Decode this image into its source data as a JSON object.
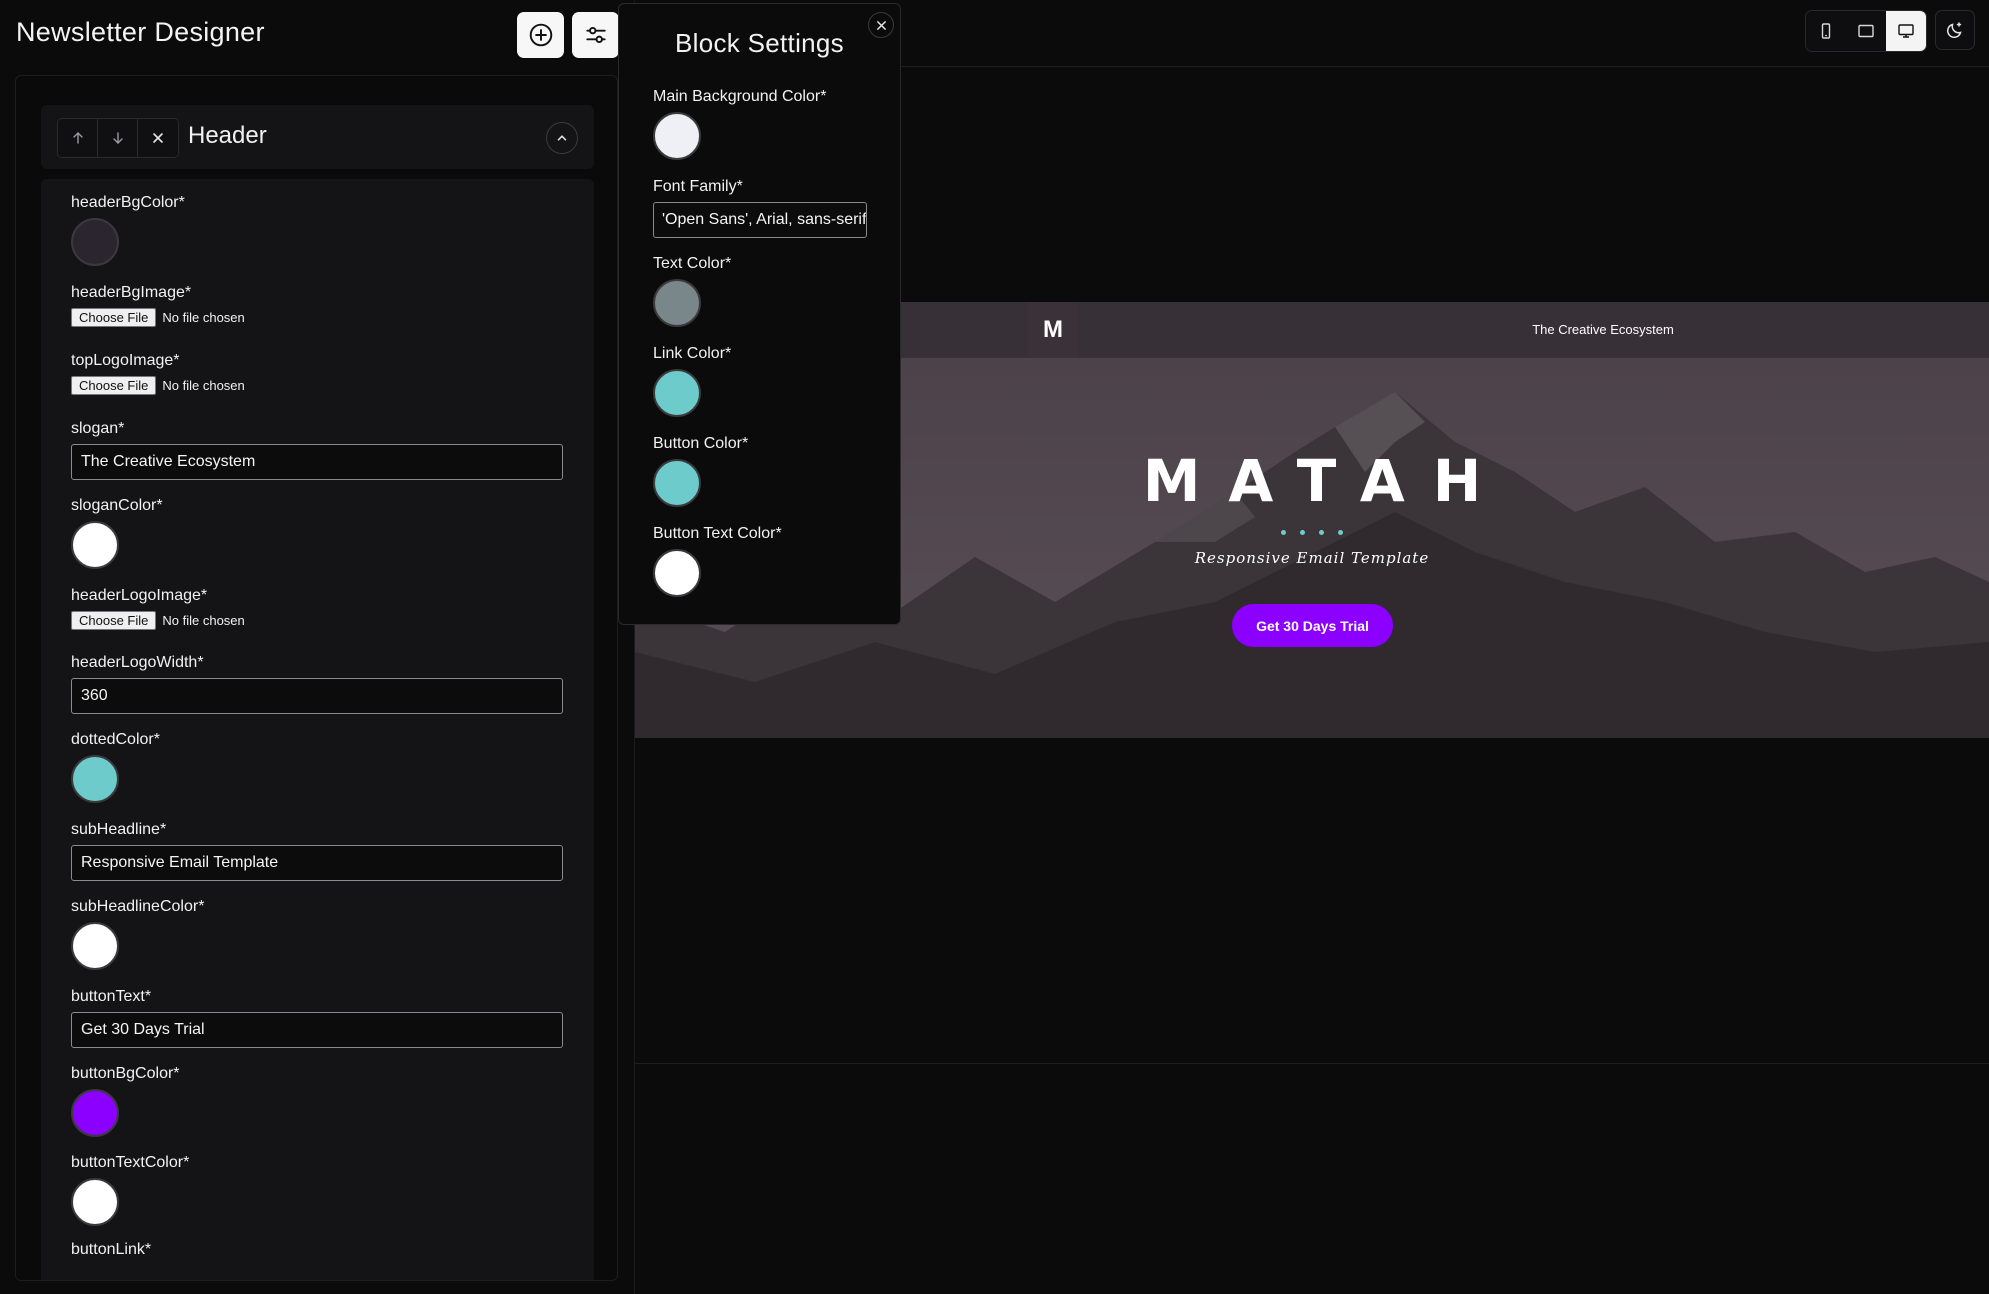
{
  "app": {
    "title": "Newsletter Designer"
  },
  "toolbar": {
    "add_icon": "plus-circle-icon",
    "settings_icon": "sliders-icon"
  },
  "block": {
    "title": "Header",
    "controls": [
      "arrow-up-icon",
      "arrow-down-icon",
      "close-icon"
    ],
    "collapse_icon": "chevron-up-icon"
  },
  "fields": {
    "headerBgColor": {
      "label": "headerBgColor*",
      "color": "#2b2530"
    },
    "headerBgImage": {
      "label": "headerBgImage*",
      "button": "Choose File",
      "status": "No file chosen"
    },
    "topLogoImage": {
      "label": "topLogoImage*",
      "button": "Choose File",
      "status": "No file chosen"
    },
    "slogan": {
      "label": "slogan*",
      "value": "The Creative Ecosystem"
    },
    "sloganColor": {
      "label": "sloganColor*",
      "color": "#ffffff"
    },
    "headerLogoImage": {
      "label": "headerLogoImage*",
      "button": "Choose File",
      "status": "No file chosen"
    },
    "headerLogoWidth": {
      "label": "headerLogoWidth*",
      "value": "360"
    },
    "dottedColor": {
      "label": "dottedColor*",
      "color": "#6ecbcb"
    },
    "subHeadline": {
      "label": "subHeadline*",
      "value": "Responsive Email Template"
    },
    "subHeadlineColor": {
      "label": "subHeadlineColor*",
      "color": "#ffffff"
    },
    "buttonText": {
      "label": "buttonText*",
      "value": "Get 30 Days Trial"
    },
    "buttonBgColor": {
      "label": "buttonBgColor*",
      "color": "#8b00ff"
    },
    "buttonTextColor": {
      "label": "buttonTextColor*",
      "color": "#ffffff"
    },
    "buttonLink": {
      "label": "buttonLink*"
    }
  },
  "settings": {
    "title": "Block Settings",
    "close_icon": "close-icon",
    "mainBg": {
      "label": "Main Background Color*",
      "color": "#eef0f5"
    },
    "fontFamily": {
      "label": "Font Family*",
      "value": "'Open Sans', Arial, sans-serif"
    },
    "textColor": {
      "label": "Text Color*",
      "color": "#7a878a"
    },
    "linkColor": {
      "label": "Link Color*",
      "color": "#6ecbcb"
    },
    "buttonColor": {
      "label": "Button Color*",
      "color": "#6ecbcb"
    },
    "buttonTextColor": {
      "label": "Button Text Color*",
      "color": "#ffffff"
    }
  },
  "devices": {
    "items": [
      "mobile-icon",
      "tablet-icon",
      "desktop-icon"
    ],
    "active": "desktop-icon",
    "theme_icon": "moon-icon"
  },
  "preview": {
    "logo_letter": "M",
    "slogan": "The Creative Ecosystem",
    "wordmark": "MATAH",
    "dots": 4,
    "dots_color": "#6ecbcb",
    "subheadline": "Responsive Email Template",
    "button": "Get 30 Days Trial",
    "button_color": "#8b00ff"
  }
}
